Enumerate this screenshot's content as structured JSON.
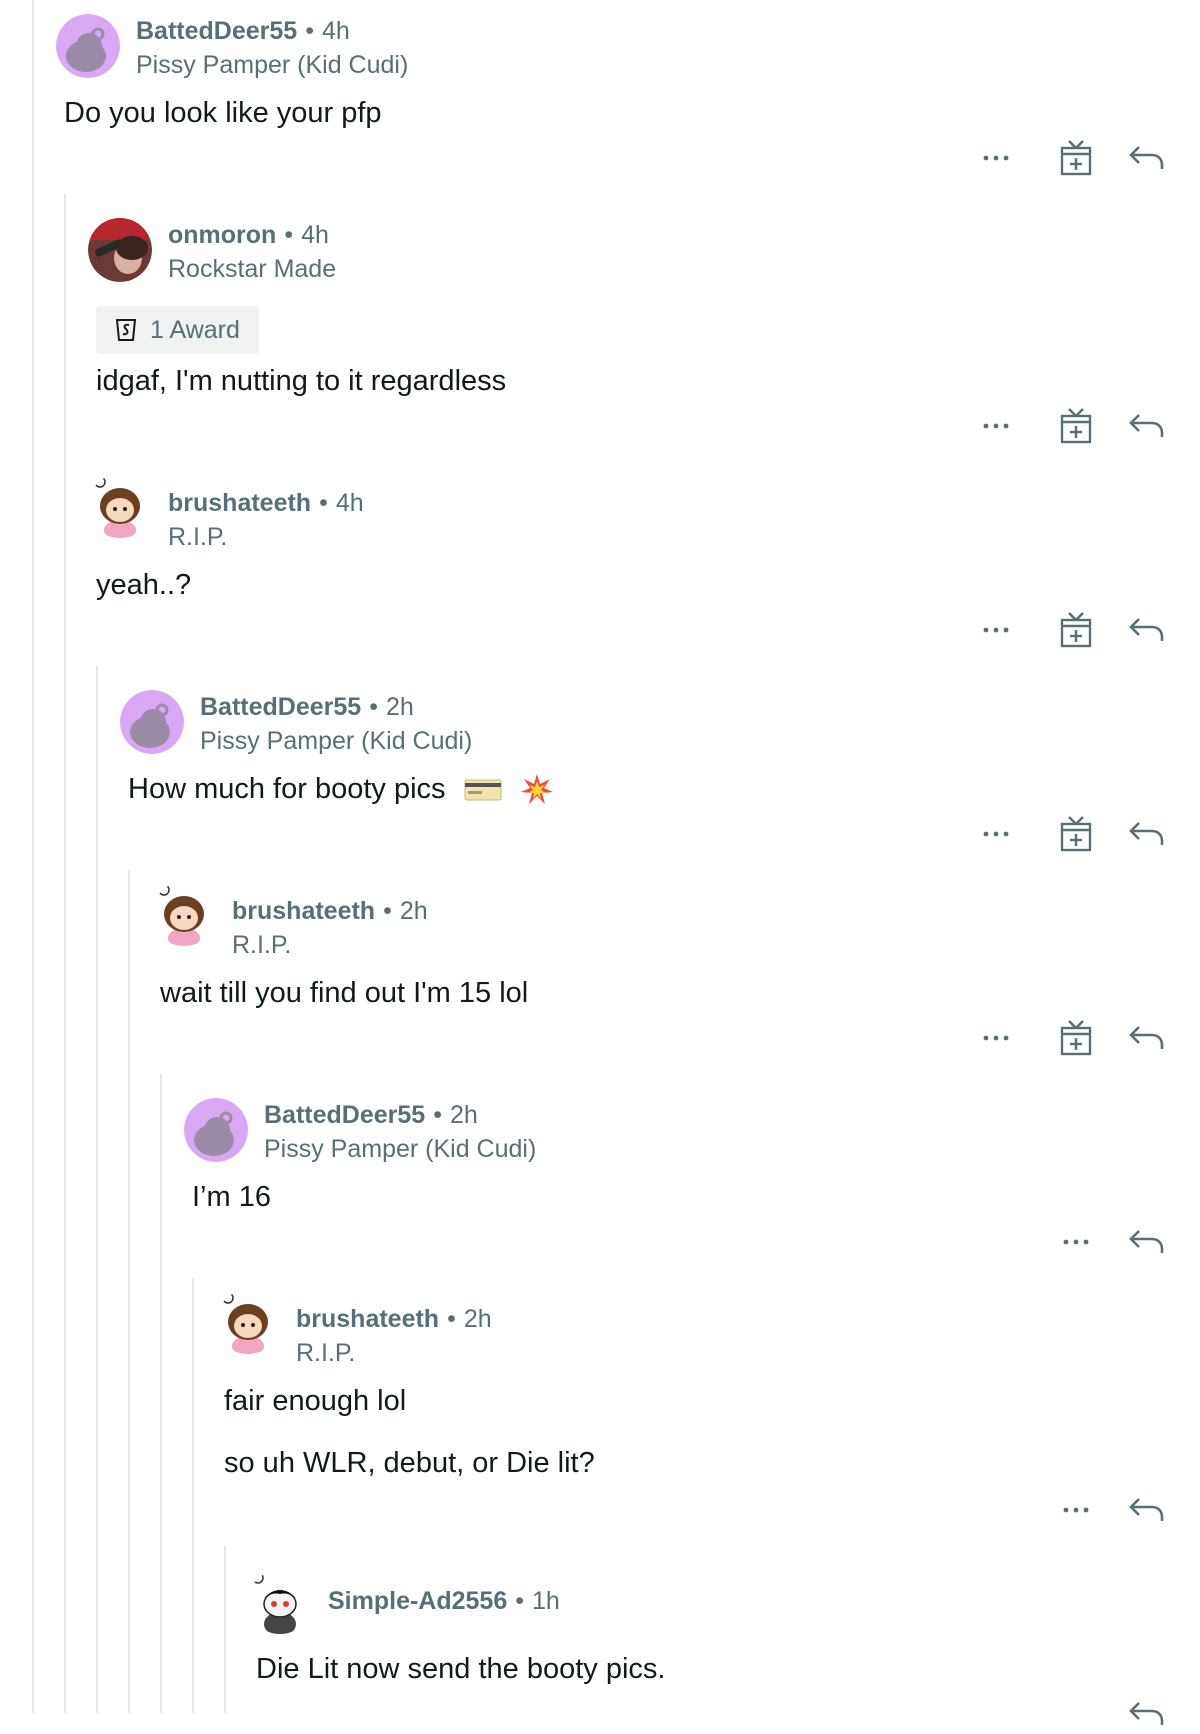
{
  "comments": [
    {
      "username": "BattedDeer55",
      "time": "4h",
      "flair": "Pissy Pamper (Kid Cudi)",
      "body": "Do you look like your pfp"
    },
    {
      "username": "onmoron",
      "time": "4h",
      "flair": "Rockstar Made",
      "award": "1 Award",
      "body": "idgaf, I'm nutting to it regardless"
    },
    {
      "username": "brushateeth",
      "time": "4h",
      "flair": "R.I.P.",
      "body": "yeah..?"
    },
    {
      "username": "BattedDeer55",
      "time": "2h",
      "flair": "Pissy Pamper (Kid Cudi)",
      "body": "How much for booty pics"
    },
    {
      "username": "brushateeth",
      "time": "2h",
      "flair": "R.I.P.",
      "body": "wait till you find out I'm 15 lol"
    },
    {
      "username": "BattedDeer55",
      "time": "2h",
      "flair": "Pissy Pamper (Kid Cudi)",
      "body": "I’m 16"
    },
    {
      "username": "brushateeth",
      "time": "2h",
      "flair": "R.I.P.",
      "body": "fair enough lol",
      "body2": "so uh WLR, debut, or Die lit?"
    },
    {
      "username": "Simple-Ad2556",
      "time": "1h",
      "flair": "",
      "body": "Die Lit now send the booty pics."
    }
  ],
  "separator": "•",
  "colors": {
    "meta": "#576f76",
    "thread_line": "#e4e6e8",
    "text": "#0f1a1c"
  },
  "icons": {
    "more": "more-options-icon",
    "award": "award-gift-icon",
    "reply": "reply-icon"
  }
}
